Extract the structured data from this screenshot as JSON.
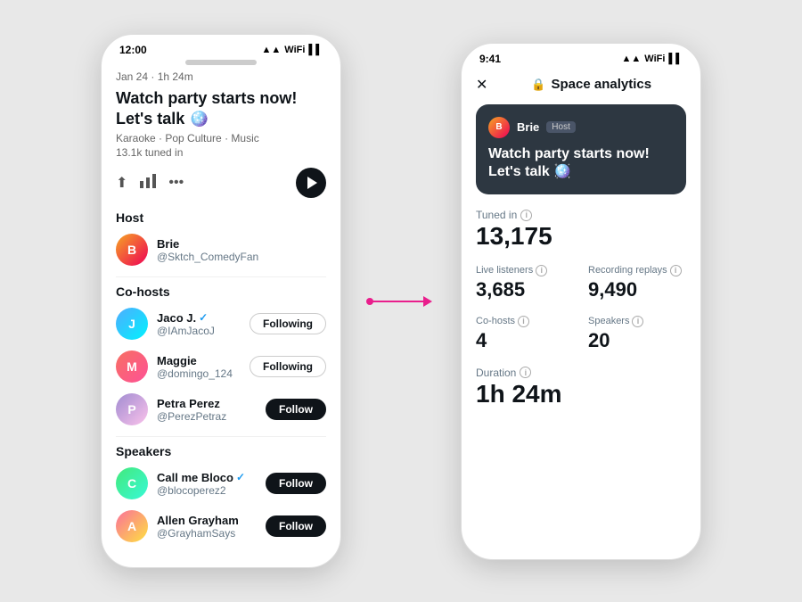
{
  "background": "#e8e8e8",
  "phone_left": {
    "status_bar": {
      "time": "12:00",
      "icons": "▲▲ 📶 🔋"
    },
    "space": {
      "meta": "Jan 24 · 1h 24m",
      "title": "Watch party starts now!\nLet's talk 🪩",
      "tags": "Karaoke · Pop Culture · Music",
      "tuned": "13.1k tuned in"
    },
    "toolbar": {
      "share_icon": "↑",
      "chart_icon": "📊",
      "more_icon": "•••"
    },
    "host_section": {
      "label": "Host",
      "host": {
        "name": "Brie",
        "handle": "@Sktch_ComedyFan"
      }
    },
    "cohosts_section": {
      "label": "Co-hosts",
      "cohosts": [
        {
          "name": "Jaco J.",
          "handle": "@IAmJacoJ",
          "verified": true,
          "button": "Following",
          "filled": false
        },
        {
          "name": "Maggie",
          "handle": "@domingo_124",
          "verified": false,
          "button": "Following",
          "filled": false
        },
        {
          "name": "Petra Perez",
          "handle": "@PerezPetraz",
          "verified": false,
          "button": "Follow",
          "filled": true
        }
      ]
    },
    "speakers_section": {
      "label": "Speakers",
      "speakers": [
        {
          "name": "Call me Bloco",
          "handle": "@blocoperez2",
          "verified": true,
          "button": "Follow",
          "filled": true
        },
        {
          "name": "Allen Grayham",
          "handle": "@GrayhamSays",
          "verified": false,
          "button": "Follow",
          "filled": true
        }
      ]
    }
  },
  "phone_right": {
    "status_bar": {
      "time": "9:41",
      "icons": "▲▲ 📶 🔋"
    },
    "header": {
      "close": "✕",
      "lock": "🔒",
      "title": "Space analytics"
    },
    "space_card": {
      "host_name": "Brie",
      "host_tag": "Host",
      "title": "Watch party starts now! Let's talk 🪩"
    },
    "metrics": {
      "tuned_in_label": "Tuned in",
      "tuned_in_value": "13,175",
      "live_listeners_label": "Live listeners",
      "live_listeners_value": "3,685",
      "recording_replays_label": "Recording replays",
      "recording_replays_value": "9,490",
      "cohosts_label": "Co-hosts",
      "cohosts_value": "4",
      "speakers_label": "Speakers",
      "speakers_value": "20",
      "duration_label": "Duration",
      "duration_value": "1h 24m"
    }
  },
  "arrow": {
    "color": "#e91e8c"
  }
}
